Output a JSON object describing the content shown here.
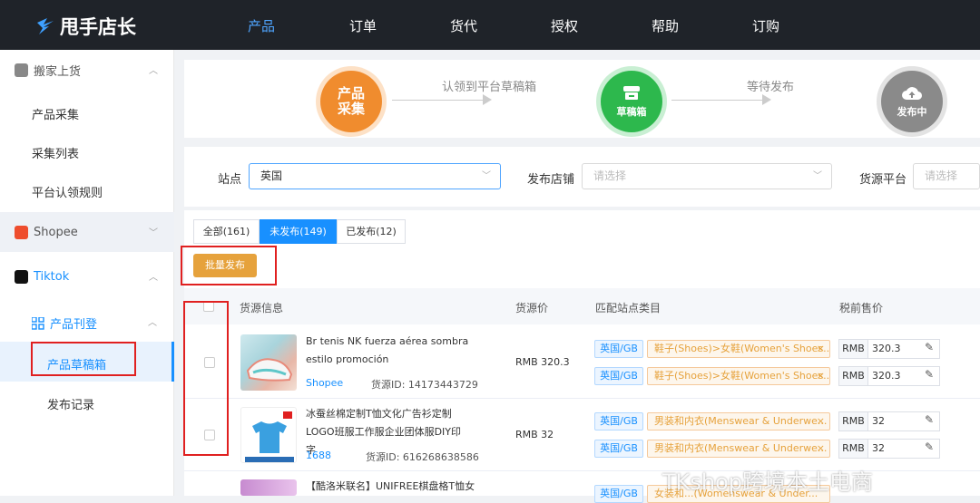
{
  "brand": {
    "name": "甩手店长"
  },
  "nav": [
    "产品",
    "订单",
    "货代",
    "授权",
    "帮助",
    "订购"
  ],
  "sidebar": {
    "group1": {
      "label": "搬家上货",
      "items": [
        "产品采集",
        "采集列表",
        "平台认领规则"
      ]
    },
    "shopee": {
      "label": "Shopee"
    },
    "tiktok": {
      "label": "Tiktok"
    },
    "sub": {
      "label": "产品刊登",
      "items": [
        "产品草稿箱",
        "发布记录"
      ]
    }
  },
  "steps": {
    "step1": {
      "line1": "产品",
      "line2": "采集"
    },
    "arrow1": "认领到平台草稿箱",
    "step2": {
      "label": "草稿箱"
    },
    "arrow2": "等待发布",
    "step3": {
      "label": "发布中"
    }
  },
  "filter": {
    "site_label": "站点",
    "site_value": "英国",
    "store_label": "发布店铺",
    "store_placeholder": "请选择",
    "source_label": "货源平台",
    "source_placeholder": "请选择"
  },
  "tabs": [
    "全部(161)",
    "未发布(149)",
    "已发布(12)"
  ],
  "batch_button": "批量发布",
  "table": {
    "headers": [
      "货源信息",
      "货源价",
      "匹配站点类目",
      "税前售价"
    ],
    "rows": [
      {
        "title": "Br tenis NK fuerza aérea sombra estilo promoción",
        "platform": "Shopee",
        "source_id": "货源ID:  14173443729",
        "price": "RMB 320.3",
        "matches": [
          {
            "region": "英国/GB",
            "category": "鞋子(Shoes)>女鞋(Women's Shoes...",
            "currency": "RMB",
            "value": "320.3"
          },
          {
            "region": "英国/GB",
            "category": "鞋子(Shoes)>女鞋(Women's Shoes...",
            "currency": "RMB",
            "value": "320.3"
          }
        ]
      },
      {
        "title": "冰蚕丝棉定制T恤文化广告衫定制LOGO班服工作服企业团体服DIY印字",
        "platform": "1688",
        "source_id": "货源ID:  616268638586",
        "price": "RMB 32",
        "matches": [
          {
            "region": "英国/GB",
            "category": "男装和内衣(Menswear & Underwe...",
            "currency": "RMB",
            "value": "32"
          },
          {
            "region": "英国/GB",
            "category": "男装和内衣(Menswear & Underwe...",
            "currency": "RMB",
            "value": "32"
          }
        ]
      },
      {
        "title": "【酷洛米联名】UNIFREE棋盘格T恤女",
        "matches": [
          {
            "region": "英国/GB",
            "category": "女装和...(Womenswear & Under..."
          }
        ]
      }
    ]
  },
  "watermark": "TKshop跨境本土电商",
  "colors": {
    "topbar": "#1f2329",
    "accent": "#1890ff",
    "orange": "#f08c2e",
    "green": "#2db84d",
    "grey": "#8a8a8a",
    "highlight_box": "#e02020"
  }
}
